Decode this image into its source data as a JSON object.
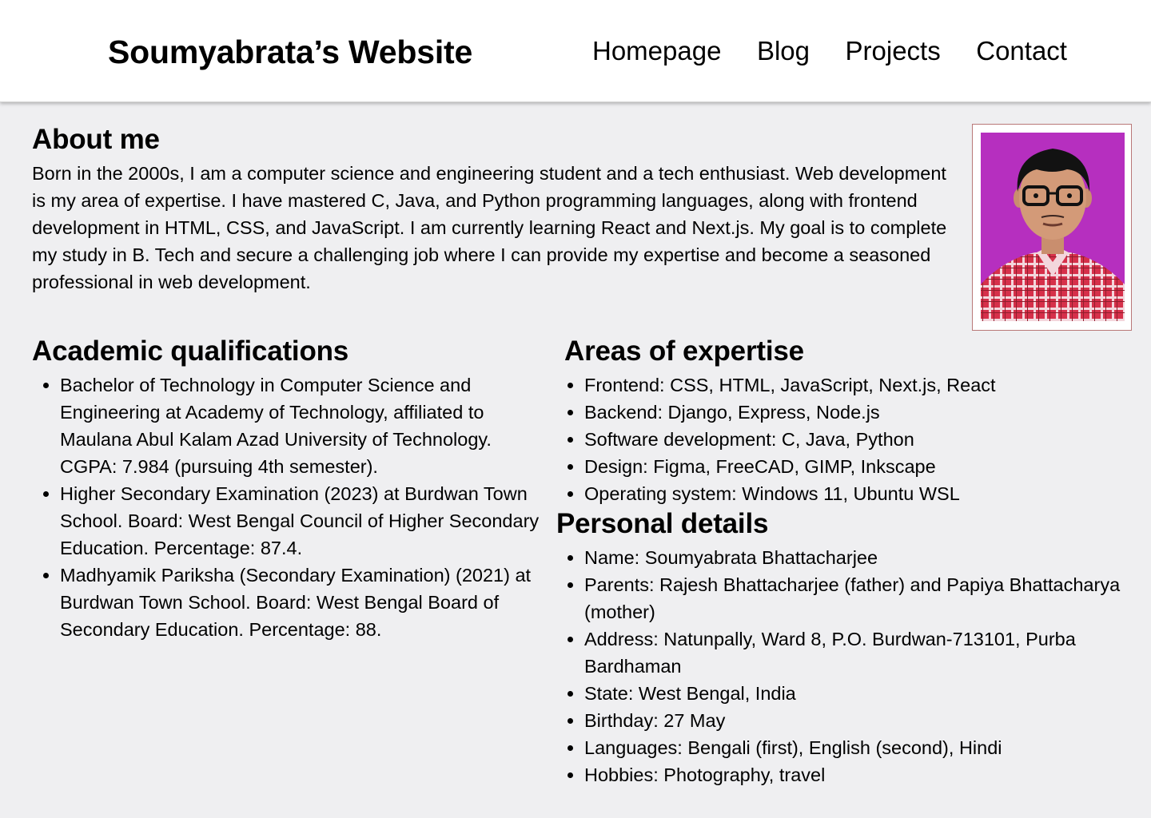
{
  "header": {
    "site_title": "Soumyabrata’s Website",
    "nav": [
      "Homepage",
      "Blog",
      "Projects",
      "Contact"
    ]
  },
  "about": {
    "heading": "About me",
    "text": "Born in the 2000s, I am a computer science and engineering student and a tech enthusiast. Web development is my area of expertise. I have mastered C, Java, and Python programming languages, along with frontend development in HTML, CSS, and JavaScript. I am currently learning React and Next.js. My goal is to complete my study in B. Tech and secure a challenging job where I can provide my expertise and become a seasoned professional in web development."
  },
  "academic": {
    "heading": "Academic qualifications",
    "items": [
      "Bachelor of Technology in Computer Science and Engineering at Academy of Technology, affiliated to Maulana Abul Kalam Azad University of Technology. CGPA: 7.984 (pursuing 4th semester).",
      "Higher Secondary Examination (2023) at Burdwan Town School. Board: West Bengal Council of Higher Secondary Education. Percentage: 87.4.",
      "Madhyamik Pariksha (Secondary Examination) (2021) at Burdwan Town School. Board: West Bengal Board of Secondary Education. Percentage: 88."
    ]
  },
  "expertise": {
    "heading": "Areas of expertise",
    "items": [
      "Frontend: CSS, HTML, JavaScript, Next.js, React",
      "Backend: Django, Express, Node.js",
      "Software development: C, Java, Python",
      "Design: Figma, FreeCAD, GIMP, Inkscape",
      "Operating system: Windows 11, Ubuntu WSL"
    ]
  },
  "personal": {
    "heading": "Personal details",
    "items": [
      "Name: Soumyabrata Bhattacharjee",
      "Parents: Rajesh Bhattacharjee (father) and Papiya Bhattacharya (mother)",
      "Address: Natunpally, Ward 8, P.O. Burdwan-713101, Purba Bardhaman",
      "State: West Bengal, India",
      "Birthday: 27 May",
      "Languages: Bengali (first), English (second), Hindi",
      "Hobbies: Photography, travel"
    ]
  },
  "colors": {
    "page_background": "#efeff1",
    "header_background": "#ffffff",
    "photo_background": "#b62fbf",
    "shirt": "#d6304a"
  }
}
